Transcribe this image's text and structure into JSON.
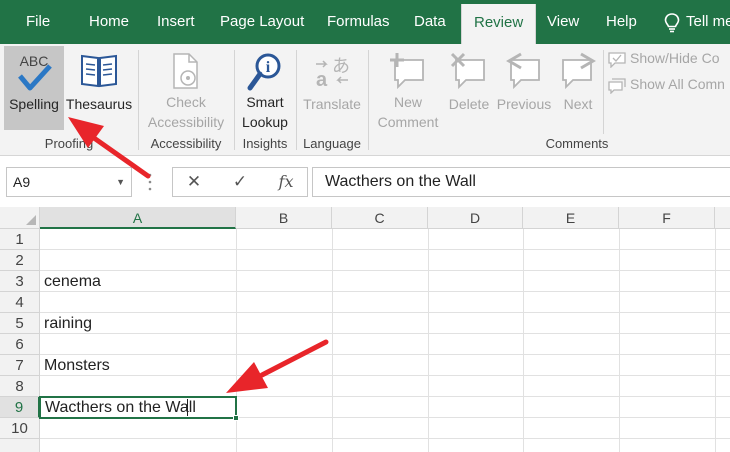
{
  "tabs": [
    {
      "label": "File",
      "active": false
    },
    {
      "label": "Home",
      "active": false
    },
    {
      "label": "Insert",
      "active": false
    },
    {
      "label": "Page Layout",
      "active": false
    },
    {
      "label": "Formulas",
      "active": false
    },
    {
      "label": "Data",
      "active": false
    },
    {
      "label": "Review",
      "active": true
    },
    {
      "label": "View",
      "active": false
    },
    {
      "label": "Help",
      "active": false
    }
  ],
  "tell_me": "Tell me",
  "ribbon": {
    "spelling_icon_text": "ABC",
    "buttons": {
      "spelling": "Spelling",
      "thesaurus": "Thesaurus",
      "check_line1": "Check",
      "check_line2": "Accessibility",
      "smart_line1": "Smart",
      "smart_line2": "Lookup",
      "translate": "Translate",
      "new_line1": "New",
      "new_line2": "Comment",
      "delete": "Delete",
      "previous": "Previous",
      "next": "Next",
      "show_hide": "Show/Hide Co",
      "show_all": "Show All Comn"
    },
    "groups": {
      "proofing": "Proofing",
      "accessibility": "Accessibility",
      "insights": "Insights",
      "language": "Language",
      "comments": "Comments"
    }
  },
  "formula_bar": {
    "name_box": "A9",
    "cancel": "✕",
    "enter": "✓",
    "fx": "fx",
    "value": "Wacthers on the Wall"
  },
  "sheet": {
    "columns": [
      "A",
      "B",
      "C",
      "D",
      "E",
      "F"
    ],
    "rows": [
      "1",
      "2",
      "3",
      "4",
      "5",
      "6",
      "7",
      "8",
      "9",
      "10"
    ],
    "cells": {
      "A3": "cenema",
      "A5": "raining",
      "A7": "Monsters",
      "A9": "Wacthers on the Wall"
    },
    "selected_column": "A",
    "selected_row": "9"
  },
  "colors": {
    "ribbon_green": "#217346",
    "arrow_red": "#e8252a"
  }
}
